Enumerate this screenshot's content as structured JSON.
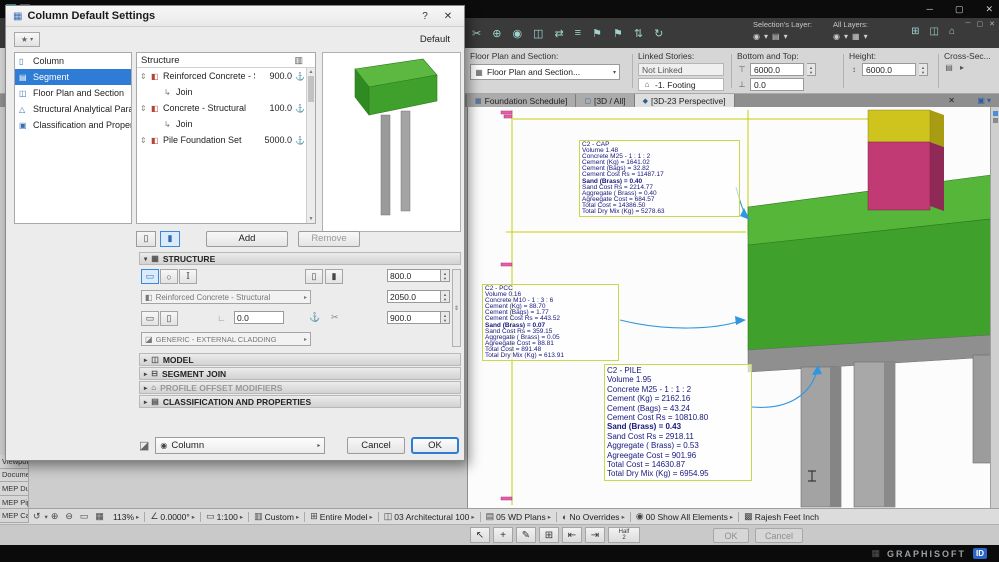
{
  "window": {
    "controls": {
      "minimize": "─",
      "maximize": "▢",
      "close": "✕"
    }
  },
  "toolbar": {
    "icons": [
      "✂",
      "⊕",
      "◉",
      "◫",
      "⇄",
      "≡",
      "⚑",
      "⚑",
      "⇅",
      "↻"
    ],
    "right_icons": [
      "⊞",
      "◫",
      "⌂"
    ],
    "mdi_controls": [
      "─",
      "▢",
      "✕"
    ]
  },
  "infobar": {
    "fps_label": "Floor Plan and Section:",
    "fps_value": "Floor Plan and Section...",
    "linked_label": "Linked Stories:",
    "linked_value": "Not Linked",
    "linked_sub": "-1. Footing",
    "bt_label": "Bottom and Top:",
    "bottom_value": "6000.0",
    "top_value": "0.0",
    "height_label": "Height:",
    "height_value": "6000.0",
    "cross_label": "Cross-Sec...",
    "sel_layer_label": "Selection's Layer:",
    "all_layers_label": "All Layers:"
  },
  "tabbar": {
    "tabs": [
      {
        "ic": "▦",
        "label": "Foundation Schedule]"
      },
      {
        "ic": "▢",
        "label": "[3D / All]"
      },
      {
        "ic": "◆",
        "label": "[3D-23 Perspective]",
        "cls": "active"
      }
    ],
    "close": "✕",
    "stack_icon": "▣",
    "stack_arrow": "▾"
  },
  "dialog": {
    "title": "Column Default Settings",
    "help": "?",
    "close": "✕",
    "favorite_icon": "★",
    "favorite_arrow": "▾",
    "default_label": "Default",
    "sidebar": {
      "items": [
        {
          "ic": "▯",
          "label": "Column"
        },
        {
          "ic": "▤",
          "label": "Segment",
          "cls": "sel"
        },
        {
          "ic": "◫",
          "label": "Floor Plan and Section"
        },
        {
          "ic": "△",
          "label": "Structural Analytical Parameters"
        },
        {
          "ic": "▣",
          "label": "Classification and Properties"
        }
      ]
    },
    "tree": {
      "header": "Structure",
      "header_icon": "▥",
      "rows": [
        {
          "h": "⇕",
          "ic": "◧",
          "label": "Reinforced Concrete - Str...",
          "value": "900.0",
          "pin": "⚓"
        },
        {
          "ic": "↳",
          "label": "Join",
          "cls": "join"
        },
        {
          "h": "⇕",
          "ic": "◧",
          "label": "Concrete - Structural",
          "value": "100.0",
          "pin": "⚓"
        },
        {
          "ic": "↳",
          "label": "Join",
          "cls": "join"
        },
        {
          "h": "⇕",
          "ic": "◧",
          "label": "Pile Foundation Set",
          "value": "5000.0",
          "pin": "⚓"
        }
      ]
    },
    "buttons": {
      "add": "Add",
      "remove": "Remove"
    },
    "structure_section": {
      "arrow": "▾",
      "ic": "▦",
      "label": "STRUCTURE"
    },
    "collapsed_sections": [
      {
        "arrow": "▸",
        "ic": "◫",
        "label": "MODEL"
      },
      {
        "arrow": "▸",
        "ic": "⊟",
        "label": "SEGMENT JOIN"
      },
      {
        "arrow": "▸",
        "ic": "⌂",
        "label": "PROFILE OFFSET MODIFIERS",
        "cls": "dis"
      },
      {
        "arrow": "▸",
        "ic": "▤",
        "label": "CLASSIFICATION AND PROPERTIES"
      }
    ],
    "structure": {
      "material": "Reinforced Concrete - Structural",
      "cladding": "GENERIC - EXTERNAL CLADDING",
      "field_top": "800.0",
      "field_mid": "2050.0",
      "field_bottom": "900.0",
      "offset": "0.0"
    },
    "footer": {
      "element_icon": "◉",
      "element_label": "Column",
      "cancel": "Cancel",
      "ok": "OK"
    }
  },
  "viewport": {
    "annotations": {
      "cap": {
        "lines": [
          {
            "t": "C2 - CAP"
          },
          {
            "t": "Volume 1.48"
          },
          {
            "t": "Concrete M25 - 1 : 1 : 2"
          },
          {
            "t": "Cement (Kg) = 1641.02"
          },
          {
            "t": "Cement (Bags) = 32.82"
          },
          {
            "t": "Cement Cost Rs = 11487.17"
          },
          {
            "t": "Sand (Brass) = 0.40",
            "cls": "b"
          },
          {
            "t": "Sand Cost Rs = 2214.77"
          },
          {
            "t": "Aggregate ( Brass) = 0.40"
          },
          {
            "t": "Agreegate Cost = 684.57"
          },
          {
            "t": "Total Cost = 14386.50"
          },
          {
            "t": "Total Dry Mix (Kg) = 5278.63"
          }
        ]
      },
      "pcc": {
        "lines": [
          {
            "t": "C2 - PCC"
          },
          {
            "t": "Volume 0.16"
          },
          {
            "t": "Concrete M10 - 1 : 3 : 6"
          },
          {
            "t": "Cement (Kg) = 88.70"
          },
          {
            "t": "Cement (Bags) = 1.77"
          },
          {
            "t": "Cement Cost Rs = 443.52"
          },
          {
            "t": "Sand (Brass) = 0.07",
            "cls": "b"
          },
          {
            "t": "Sand Cost Rs = 359.15"
          },
          {
            "t": "Aggregate ( Brass) = 0.05"
          },
          {
            "t": "Agreegate Cost = 88.81"
          },
          {
            "t": "Total Cost = 891.48"
          },
          {
            "t": "Total Dry Mix (Kg) = 613.91"
          }
        ]
      },
      "pile": {
        "lines": [
          {
            "t": "C2 - PILE"
          },
          {
            "t": "Volume 1.95"
          },
          {
            "t": "Concrete M25 - 1 : 1 : 2"
          },
          {
            "t": "Cement (Kg) = 2162.16"
          },
          {
            "t": "Cement (Bags) = 43.24"
          },
          {
            "t": "Cement Cost Rs = 10810.80"
          },
          {
            "t": "Sand (Brass) = 0.43",
            "cls": "b"
          },
          {
            "t": "Sand Cost Rs = 2918.11"
          },
          {
            "t": "Aggregate ( Brass) = 0.53"
          },
          {
            "t": "Agreegate Cost = 901.96"
          },
          {
            "t": "Total Cost = 14630.87"
          },
          {
            "t": "Total Dry Mix (Kg) = 6954.95"
          }
        ]
      }
    }
  },
  "left_stubs": [
    {
      "label": "Viewpoint"
    },
    {
      "label": "Documen"
    },
    {
      "label": "MEP Duc"
    },
    {
      "label": "MEP Pipe"
    },
    {
      "label": "MEP Cab"
    }
  ],
  "statusbar": {
    "items": [
      {
        "ic": "↺",
        "ch": "▾"
      },
      {
        "ic": "⊕"
      },
      {
        "ic": "⊖"
      },
      {
        "ic": "▭"
      },
      {
        "ic": "▦"
      },
      {
        "label": "113%",
        "ch": "▸"
      },
      {
        "cls": "sep"
      },
      {
        "ic": "∠",
        "label": "0.0000°",
        "ch": "▸"
      },
      {
        "cls": "sep"
      },
      {
        "ic": "▭",
        "label": "1:100",
        "ch": "▸"
      },
      {
        "cls": "sep"
      },
      {
        "ic": "▥",
        "label": "Custom",
        "ch": "▸"
      },
      {
        "cls": "sep"
      },
      {
        "ic": "⊞",
        "label": "Entire Model",
        "ch": "▸"
      },
      {
        "cls": "sep"
      },
      {
        "ic": "◫",
        "label": "03 Architectural 100",
        "ch": "▸"
      },
      {
        "cls": "sep"
      },
      {
        "ic": "▤",
        "label": "05 WD Plans",
        "ch": "▸"
      },
      {
        "cls": "sep"
      },
      {
        "ic": "◐",
        "label": "No Overrides",
        "ch": "▸"
      },
      {
        "cls": "sep"
      },
      {
        "ic": "◉",
        "label": "00 Show All Elements",
        "ch": "▸"
      },
      {
        "cls": "sep"
      },
      {
        "ic": "▩",
        "label": "Rajesh Feet Inch"
      }
    ]
  },
  "toolrow": {
    "icons": [
      "↖",
      "+",
      "✎",
      "⊞",
      "⇤",
      "⇥"
    ],
    "half": "Half",
    "half_den": "2",
    "ok": "OK",
    "cancel": "Cancel"
  },
  "bottombar": {
    "icon": "▦",
    "brand": "GRAPHISOFT",
    "badge": "ID"
  },
  "colors": {
    "accent_blue": "#2e7cd6",
    "leader_blue": "#2f97e0",
    "cap_green_top": "#56b63a",
    "cap_green_front": "#3fa02c",
    "pile_gray": "#a3a3a3",
    "column_magenta": "#c23a74",
    "column_yellow": "#cfc41d",
    "guide_yellow": "#c3cf08",
    "annotation_navy": "#17177d"
  }
}
